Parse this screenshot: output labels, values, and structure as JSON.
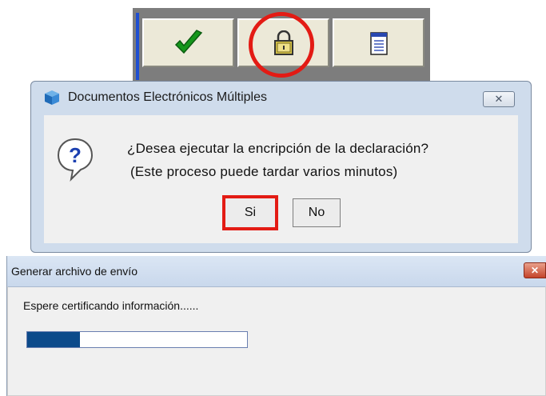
{
  "toolbar": {
    "buttons": [
      {
        "name": "checkmark-icon",
        "color": "#1a9a1a"
      },
      {
        "name": "padlock-icon",
        "color": "#d6c240"
      },
      {
        "name": "notepad-icon",
        "color": "#3a55b8"
      }
    ],
    "highlight_color": "#e31b14"
  },
  "dialog_confirm": {
    "title": "Documentos Electrónicos Múltiples",
    "close_label": "✕",
    "message_line1": "¿Desea ejecutar la encripción de la declaración?",
    "message_line2": "(Este proceso puede tardar varios minutos)",
    "yes_label": "Si",
    "no_label": "No",
    "icon": "question-icon"
  },
  "dialog_progress": {
    "title": "Generar archivo de envío",
    "close_label": "✕",
    "status_text": "Espere certificando información......",
    "progress_fraction": 0.24,
    "progress_color": "#0c4a8a"
  }
}
